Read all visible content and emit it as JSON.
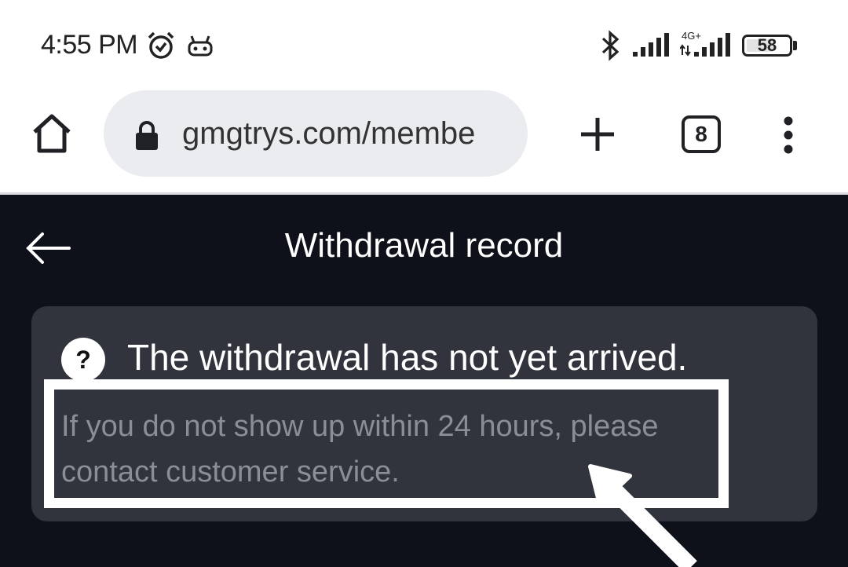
{
  "status_bar": {
    "time": "4:55 PM",
    "network_label": "4G+",
    "battery": "58",
    "icons": [
      "alarm-icon",
      "robot-icon",
      "bluetooth-icon",
      "signal-icon",
      "signal-4g-icon",
      "battery-icon"
    ]
  },
  "browser": {
    "url": "gmgtrys.com/membe",
    "tab_count": "8",
    "icons": [
      "home-icon",
      "lock-icon",
      "plus-icon",
      "menu-icon"
    ]
  },
  "page": {
    "title": "Withdrawal record",
    "back_icon": "back-arrow-icon"
  },
  "faq_card": {
    "title": "The withdrawal has not yet arrived.",
    "description": "If you do not show up within 24 hours, please contact customer service.",
    "icon": "question-icon",
    "icon_glyph": "?"
  },
  "colors": {
    "page_background": "#0f111a",
    "card_background": "#31333d",
    "description_text": "#8b8e98",
    "highlight_annotation": "#ffffff"
  }
}
